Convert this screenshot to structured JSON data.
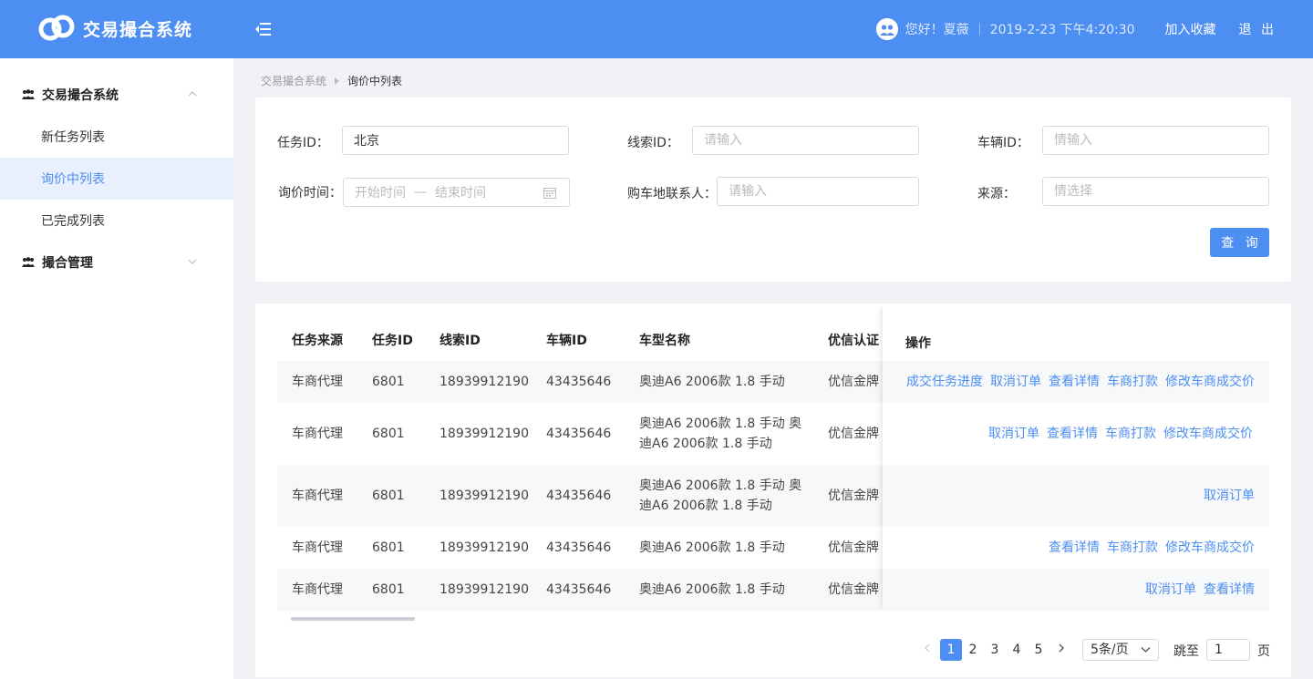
{
  "header": {
    "app_title": "交易撮合系统",
    "greeting": "您好！夏薇",
    "datetime": "2019-2-23 下午4:20:30",
    "favorite_label": "加入收藏",
    "logout_label": "退 出",
    "brand_color": "#4c8ef2"
  },
  "sidebar": {
    "groups": [
      {
        "label": "交易撮合系统",
        "icon": "team-icon",
        "expanded": true,
        "items": [
          {
            "label": "新任务列表",
            "active": false
          },
          {
            "label": "询价中列表",
            "active": true
          },
          {
            "label": "已完成列表",
            "active": false
          }
        ]
      },
      {
        "label": "撮合管理",
        "icon": "team-icon",
        "expanded": false,
        "items": []
      }
    ]
  },
  "breadcrumb": {
    "home": "交易撮合系统",
    "current": "询价中列表"
  },
  "filters": {
    "task_id": {
      "label": "任务ID：",
      "value": "北京",
      "placeholder": ""
    },
    "lead_id": {
      "label": "线索ID：",
      "value": "",
      "placeholder": "请输入"
    },
    "vehicle_id": {
      "label": "车辆ID：",
      "value": "",
      "placeholder": "情输入"
    },
    "inquiry_time": {
      "label": "询价时间：",
      "start_placeholder": "开始时间",
      "separator": "—",
      "end_placeholder": "结束时间"
    },
    "contact": {
      "label": "购车地联系人：",
      "value": "",
      "placeholder": "请输入"
    },
    "source": {
      "label": "来源：",
      "value": "",
      "placeholder": "情选择"
    },
    "search_label": "查 询"
  },
  "table": {
    "columns": [
      "任务来源",
      "任务ID",
      "线索ID",
      "车辆ID",
      "车型名称",
      "优信认证",
      "操作"
    ],
    "rows": [
      {
        "source": "车商代理",
        "task_id": "6801",
        "lead_id": "18939912190",
        "vehicle_id": "43435646",
        "model": "奥迪A6 2006款 1.8 手动",
        "cert": "优信金牌",
        "ops": [
          "成交任务进度",
          "取消订单",
          "查看详情",
          "车商打款",
          "修改车商成交价"
        ]
      },
      {
        "source": "车商代理",
        "task_id": "6801",
        "lead_id": "18939912190",
        "vehicle_id": "43435646",
        "model": "奥迪A6 2006款 1.8 手动 奥迪A6 2006款 1.8 手动",
        "cert": "优信金牌",
        "ops": [
          "取消订单",
          "查看详情",
          "车商打款",
          "修改车商成交价"
        ]
      },
      {
        "source": "车商代理",
        "task_id": "6801",
        "lead_id": "18939912190",
        "vehicle_id": "43435646",
        "model": "奥迪A6 2006款 1.8 手动 奥迪A6 2006款 1.8 手动",
        "cert": "优信金牌",
        "ops": [
          "取消订单"
        ]
      },
      {
        "source": "车商代理",
        "task_id": "6801",
        "lead_id": "18939912190",
        "vehicle_id": "43435646",
        "model": "奥迪A6 2006款 1.8 手动",
        "cert": "优信金牌",
        "ops": [
          "查看详情",
          "车商打款",
          "修改车商成交价"
        ]
      },
      {
        "source": "车商代理",
        "task_id": "6801",
        "lead_id": "18939912190",
        "vehicle_id": "43435646",
        "model": "奥迪A6 2006款 1.8 手动",
        "cert": "优信金牌",
        "ops": [
          "取消订单",
          "查看详情"
        ]
      }
    ]
  },
  "pagination": {
    "pages": [
      "1",
      "2",
      "3",
      "4",
      "5"
    ],
    "current_page": "1",
    "page_size": "5条/页",
    "jump_label": "跳至",
    "jump_value": "1",
    "page_suffix": "页"
  }
}
